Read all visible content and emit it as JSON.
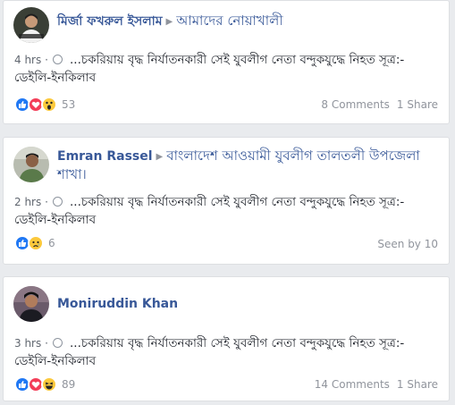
{
  "posts": [
    {
      "author": "মির্জা ফখরুল ইসলাম",
      "group": "আমাদের নোয়াখালী",
      "time": "4 hrs",
      "dot": "·",
      "text": "...চকরিয়ায় বৃদ্ধ নির্যাতনকারী সেই যুবলীগ নেতা বন্দুকযুদ্ধে নিহত সূত্র:-ডেইলি-ইনকিলাব",
      "reaction_icons": [
        "like-icon",
        "love-icon",
        "wow-icon"
      ],
      "reaction_count": "53",
      "comments": "8 Comments",
      "shares": "1 Share"
    },
    {
      "author": "Emran Rassel",
      "group": "বাংলাদেশ আওয়ামী যুবলীগ তালতলী উপজেলা শাখা।",
      "time": "2 hrs",
      "dot": "·",
      "text": "...চকরিয়ায় বৃদ্ধ নির্যাতনকারী সেই যুবলীগ নেতা বন্দুকযুদ্ধে নিহত সূত্র:-ডেইলি-ইনকিলাব",
      "reaction_icons": [
        "like-icon",
        "sad-icon"
      ],
      "reaction_count": "6",
      "seen_by": "Seen by 10"
    },
    {
      "author": "Moniruddin Khan",
      "time": "3 hrs",
      "dot": "·",
      "text": "...চকরিয়ায় বৃদ্ধ নির্যাতনকারী সেই যুবলীগ নেতা বন্দুকযুদ্ধে নিহত সূত্র:-ডেইলি-ইনকিলাব",
      "reaction_icons": [
        "like-icon",
        "love-icon",
        "haha-icon"
      ],
      "reaction_count": "89",
      "comments": "14 Comments",
      "shares": "1 Share"
    }
  ],
  "colors": {
    "background": "#e9ebee",
    "link": "#385898",
    "muted": "#90949c",
    "like": "#2078f4",
    "love": "#f33e58",
    "yellow": "#fcc93c"
  }
}
